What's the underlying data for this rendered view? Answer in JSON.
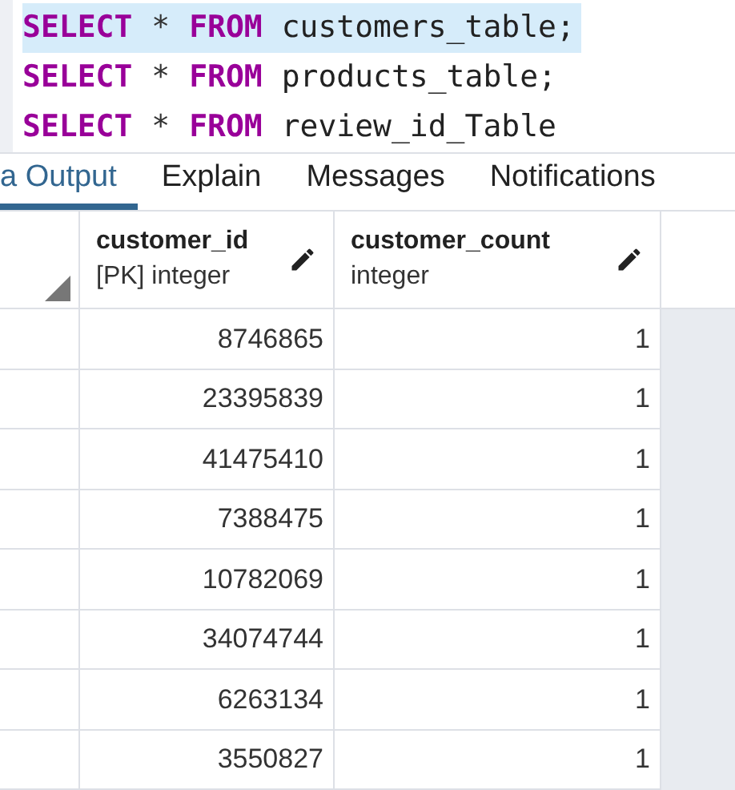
{
  "editor": {
    "lines": [
      {
        "keyword1": "SELECT",
        "operator": "*",
        "keyword2": "FROM",
        "table": "customers_table;",
        "selected": true
      },
      {
        "keyword1": "SELECT",
        "operator": "*",
        "keyword2": "FROM",
        "table": "products_table;",
        "selected": false
      },
      {
        "keyword1": "SELECT",
        "operator": "*",
        "keyword2": "FROM",
        "table": "review_id_Table",
        "selected": false
      }
    ]
  },
  "tabs": [
    {
      "label": "a Output",
      "selected": true
    },
    {
      "label": "Explain",
      "selected": false
    },
    {
      "label": "Messages",
      "selected": false
    },
    {
      "label": "Notifications",
      "selected": false
    }
  ],
  "table": {
    "columns": [
      {
        "name": "customer_id",
        "type": "[PK] integer"
      },
      {
        "name": "customer_count",
        "type": "integer"
      }
    ],
    "rows": [
      [
        "8746865",
        "1"
      ],
      [
        "23395839",
        "1"
      ],
      [
        "41475410",
        "1"
      ],
      [
        "7388475",
        "1"
      ],
      [
        "10782069",
        "1"
      ],
      [
        "34074744",
        "1"
      ],
      [
        "6263134",
        "1"
      ],
      [
        "3550827",
        "1"
      ]
    ]
  }
}
